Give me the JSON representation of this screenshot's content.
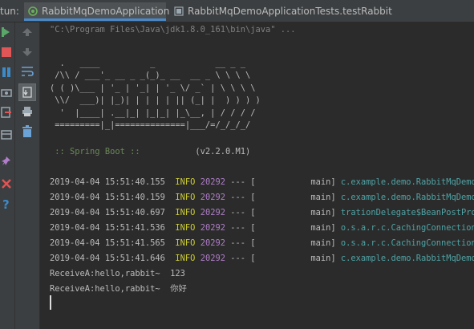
{
  "colors": {
    "info": "#cccc33",
    "pid": "#b07dc9",
    "logger": "#4fa3a5",
    "spring": "#6a8759",
    "tab_underline": "#4a88c7"
  },
  "header": {
    "run_label": "tun:",
    "tabs": [
      {
        "label": "RabbitMqDemoApplication",
        "icon": "spring-app-icon",
        "active": true
      },
      {
        "label": "RabbitMqDemoApplicationTests.testRabbit",
        "icon": "test-icon",
        "active": false
      }
    ]
  },
  "toolbar_left": [
    "rerun-icon",
    "stop-icon",
    "pause-icon",
    "camera-icon",
    "exit-icon",
    "layout-icon",
    "pin-icon",
    "close-icon",
    "help-icon"
  ],
  "toolbar_right": [
    "up-arrow-icon",
    "down-arrow-icon",
    "soft-wrap-icon",
    "scroll-to-end-icon",
    "print-icon",
    "trash-icon"
  ],
  "console": {
    "command": "\"C:\\Program Files\\Java\\jdk1.8.0_161\\bin\\java\" ...",
    "banner": [
      "  .   ____          _            __ _ _",
      " /\\\\ / ___'_ __ _ _(_)_ __  __ _ \\ \\ \\ \\",
      "( ( )\\___ | '_ | '_| | '_ \\/ _` | \\ \\ \\ \\",
      " \\\\/  ___)| |_)| | | | | || (_| |  ) ) ) )",
      "  '  |____| .__|_| |_|_| |_\\__, | / / / /",
      " =========|_|==============|___/=/_/_/_/"
    ],
    "spring_label": " :: Spring Boot :: ",
    "spring_version": "          (v2.2.0.M1)",
    "logs": [
      {
        "ts": "2019-04-04 15:51:40.155",
        "level": "INFO",
        "pid": "20292",
        "sep": "--- [",
        "thread": "           main]",
        "logger": "c.example.demo.RabbitMqDemoApp"
      },
      {
        "ts": "2019-04-04 15:51:40.159",
        "level": "INFO",
        "pid": "20292",
        "sep": "--- [",
        "thread": "           main]",
        "logger": "c.example.demo.RabbitMqDemoApp"
      },
      {
        "ts": "2019-04-04 15:51:40.697",
        "level": "INFO",
        "pid": "20292",
        "sep": "--- [",
        "thread": "           main]",
        "logger": "trationDelegate$BeanPostProces"
      },
      {
        "ts": "2019-04-04 15:51:41.536",
        "level": "INFO",
        "pid": "20292",
        "sep": "--- [",
        "thread": "           main]",
        "logger": "o.s.a.r.c.CachingConnectionFac"
      },
      {
        "ts": "2019-04-04 15:51:41.565",
        "level": "INFO",
        "pid": "20292",
        "sep": "--- [",
        "thread": "           main]",
        "logger": "o.s.a.r.c.CachingConnectionFac"
      },
      {
        "ts": "2019-04-04 15:51:41.646",
        "level": "INFO",
        "pid": "20292",
        "sep": "--- [",
        "thread": "           main]",
        "logger": "c.example.demo.RabbitMqDemoApp"
      }
    ],
    "outputs": [
      "ReceiveA:hello,rabbit~  123",
      "ReceiveA:hello,rabbit~  你好"
    ]
  }
}
